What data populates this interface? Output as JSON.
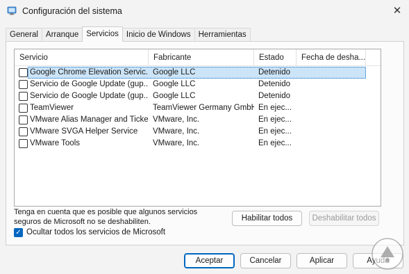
{
  "window": {
    "title": "Configuración del sistema",
    "close_glyph": "✕"
  },
  "tabs": [
    {
      "label": "General"
    },
    {
      "label": "Arranque"
    },
    {
      "label": "Servicios",
      "active": true
    },
    {
      "label": "Inicio de Windows"
    },
    {
      "label": "Herramientas"
    }
  ],
  "services": {
    "columns": [
      "Servicio",
      "Fabricante",
      "Estado",
      "Fecha de desha..."
    ],
    "rows": [
      {
        "name": "Google Chrome Elevation Servic...",
        "maker": "Google LLC",
        "state": "Detenido",
        "checked": false,
        "selected": true
      },
      {
        "name": "Servicio de Google Update (gup...",
        "maker": "Google LLC",
        "state": "Detenido",
        "checked": false
      },
      {
        "name": "Servicio de Google Update (gup...",
        "maker": "Google LLC",
        "state": "Detenido",
        "checked": false
      },
      {
        "name": "TeamViewer",
        "maker": "TeamViewer Germany GmbH",
        "state": "En ejec...",
        "checked": false
      },
      {
        "name": "VMware Alias Manager and Ticke...",
        "maker": "VMware, Inc.",
        "state": "En ejec...",
        "checked": false
      },
      {
        "name": "VMware SVGA Helper Service",
        "maker": "VMware, Inc.",
        "state": "En ejec...",
        "checked": false
      },
      {
        "name": "VMware Tools",
        "maker": "VMware, Inc.",
        "state": "En ejec...",
        "checked": false
      }
    ]
  },
  "note": {
    "line1": "Tenga en cuenta que es posible que algunos servicios",
    "line2": "seguros de Microsoft no se deshabiliten."
  },
  "actions": {
    "enable_all": "Habilitar todos",
    "disable_all": "Deshabilitar todos"
  },
  "hide_ms": {
    "label": "Ocultar todos los servicios de Microsoft",
    "checked": true,
    "check_glyph": "✓"
  },
  "footer": {
    "ok": "Aceptar",
    "cancel": "Cancelar",
    "apply": "Aplicar",
    "help": "Ayuda"
  },
  "colors": {
    "accent": "#0067c0",
    "selection": "#cce4f7"
  }
}
